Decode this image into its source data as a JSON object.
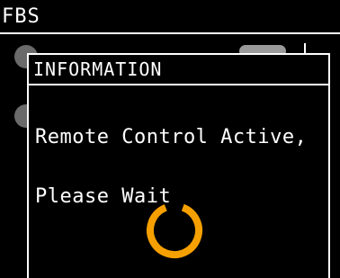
{
  "header": {
    "title": "FBS"
  },
  "dialog": {
    "title": "INFORMATION",
    "message_line1": "Remote Control Active,",
    "message_line2": "Please Wait"
  },
  "spinner": {
    "color": "#f5a000",
    "icon": "loading-spinner-icon"
  },
  "colors": {
    "background": "#000000",
    "foreground": "#ffffff",
    "accent": "#f5a000"
  }
}
